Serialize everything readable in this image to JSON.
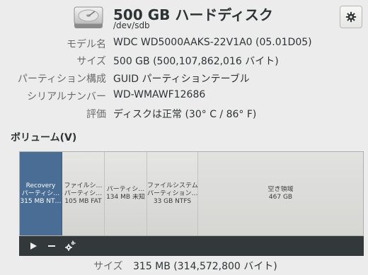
{
  "disk": {
    "title": "500 GB ハードディスク",
    "device": "/dev/sdb",
    "icon": "hard-disk-icon"
  },
  "header": {
    "settings_icon": "gear-icon"
  },
  "info": [
    {
      "label": "モデル名",
      "value": "WDC WD5000AAKS-22V1A0 (05.01D05)"
    },
    {
      "label": "サイズ",
      "value": "500 GB (500,107,862,016 バイト)"
    },
    {
      "label": "パーティション構成",
      "value": "GUID パーティションテーブル"
    },
    {
      "label": "シリアルナンバー",
      "value": "WD-WMAWF12686"
    },
    {
      "label": "評価",
      "value": "ディスクは正常 (30° C / 86° F)"
    }
  ],
  "volumes": {
    "heading": "ボリューム(V)",
    "partitions": [
      {
        "line1": "Recovery",
        "line2": "パーティシ…",
        "line3": "315 MB NT…",
        "selected": true
      },
      {
        "line1": "ファイルシ…",
        "line2": "パーティシ…",
        "line3": "105 MB FAT",
        "selected": false
      },
      {
        "line1": "パーティシ…",
        "line2": "134 MB 未知",
        "line3": "",
        "selected": false
      },
      {
        "line1": "ファイルシステム",
        "line2": "パーティション…",
        "line3": "33 GB NTFS",
        "selected": false
      },
      {
        "line1": "空き領域",
        "line2": "467 GB",
        "line3": "",
        "selected": false
      }
    ]
  },
  "toolbar": {
    "buttons": [
      "play-icon",
      "minus-icon",
      "gears-icon"
    ]
  },
  "selected_size": {
    "label": "サイズ",
    "value": "315 MB (314,572,800 バイト)"
  },
  "colors": {
    "background": "#ececec",
    "selected_partition": "#4a6d95",
    "toolbar": "#33393b"
  }
}
